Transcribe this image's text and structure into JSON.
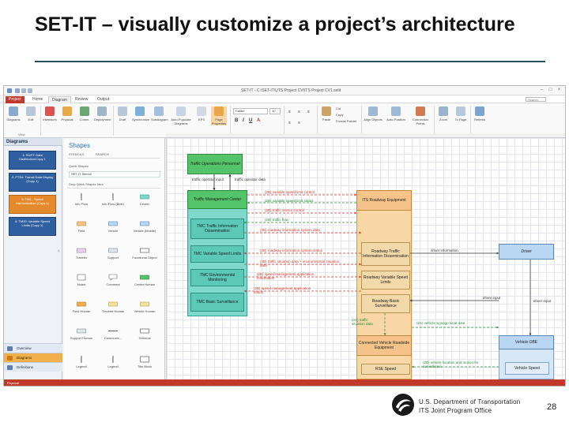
{
  "slide": {
    "title": "SET-IT – visually customize a project’s architecture",
    "page_number": "28",
    "footer_line1": "U.S. Department of Transportation",
    "footer_line2": "ITS Joint Program Office"
  },
  "app": {
    "window_caption": "SET-IT - C:\\SET-IT\\UTS Project CV\\ITS Project CV1.setit",
    "file_tab": "Project",
    "tabs": [
      "Home",
      "Diagram",
      "Review",
      "Output"
    ],
    "search_placeholder": "Search",
    "ribbon": {
      "buttons": [
        "Diagrams",
        "Edit",
        "Interfaces",
        "Physical",
        "Comm.",
        "Deployment",
        "Draft",
        "Synchronize",
        "Subdiagram",
        "Auto-Populate Diagrams",
        "EPS",
        "Page Properties",
        "Paste",
        "Cut",
        "Copy",
        "Format Painter",
        "Align Objects",
        "Auto-Position",
        "Connection Points",
        "Zoom",
        "To Page",
        "Refresh"
      ],
      "groups": [
        "View",
        "Tools",
        "Font",
        "Paragraph",
        "Clipboard",
        "Arrange",
        "Zoom",
        "Files Bar"
      ],
      "font_name": "Calibri",
      "font_size": "10"
    },
    "diagrams_panel": {
      "title": "Diagrams",
      "items": [
        "1: SUST: Data Distribution/Copy 1",
        "2: PTS4: Transit Data Display (Copy 1)",
        "3: TM2 - Speed Harmonization (Copy 1)",
        "4: TM20: Variable Speed Limits (Copy 1)"
      ],
      "nav": [
        "Overview",
        "Diagrams",
        "Definitions"
      ]
    },
    "shapes_panel": {
      "title": "Shapes",
      "tabs": [
        "STENCILS",
        "SEARCH"
      ],
      "quick_shapes_label": "Quick Shapes",
      "quick_shapes_field": "SET-IT Stencil",
      "drop_hint": "Drop Quick Shapes here",
      "shapes": [
        "Info Flow",
        "Info Flow (Bidir)",
        "Center",
        "Field",
        "Vehicle",
        "Vehicle (Mobile)",
        "Traveler",
        "Support",
        "Functional Object",
        "Notes",
        "Comment",
        "Center Human",
        "Field Human",
        "Traveler Human",
        "Vehicle Human",
        "Support Human",
        "Communic...",
        "Terminal",
        "Legend",
        "Legend",
        "Title Block"
      ]
    },
    "status_text": "Physical",
    "canvas": {
      "tops": "Traffic Operations Personnel",
      "tmc": "Traffic Management Center",
      "tmc_subs": [
        "TMC Traffic Information Dissemination",
        "TMC Variable Speed Limits",
        "TMC Environmental Monitoring",
        "TMC Basic Surveillance"
      ],
      "rse_equip": "ITS Roadway Equipment",
      "rse_subs": [
        "Roadway Traffic Information Dissemination",
        "Roadway Variable Speed Limits",
        "Roadway Basic Surveillance"
      ],
      "connected": "Connected Vehicle Roadside Equipment",
      "rse_speed": "RSE Speed",
      "driver": "Driver",
      "vehicle_obe": "Vehicle OBE",
      "vehicle_speed": "Vehicle Speed",
      "flows": [
        "traffic operator input",
        "traffic operator data",
        "(2B) variable speed limit control",
        "(2B) variable speed limit status",
        "(2B) traffic sensor control",
        "(2B) traffic flow",
        "(2B) roadway information system data",
        "(2B) roadway information system status",
        "(2B) traffic situation data + environmental situation data",
        "(2B) speed management application information",
        "(2B) speed management application status",
        "driver information",
        "driver input",
        "driver input",
        "(2A) traffic situation data",
        "(2A) vehicle signage local data",
        "(2B) vehicle location and motion for surveillance"
      ]
    }
  }
}
